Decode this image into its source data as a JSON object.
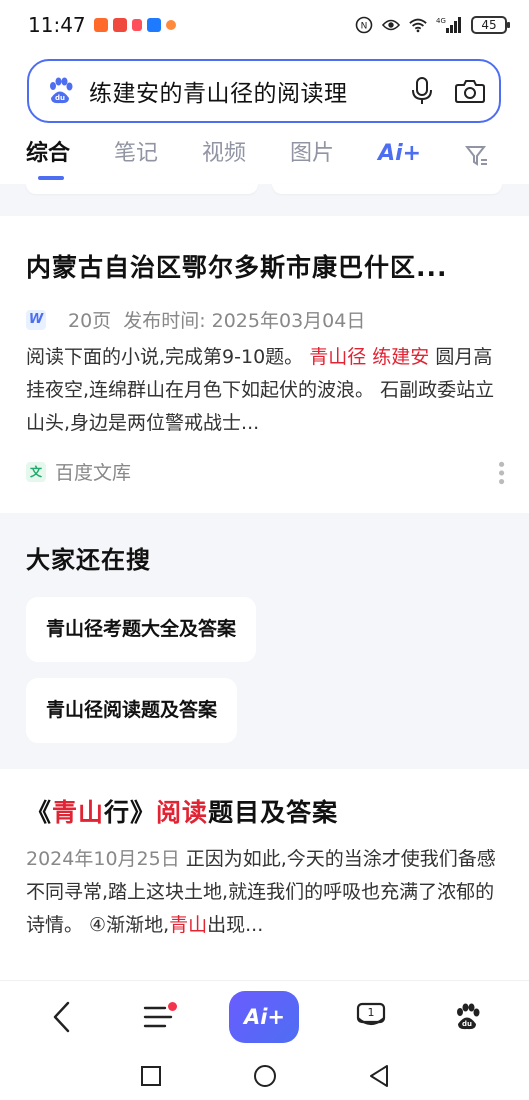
{
  "status_bar": {
    "time": "11:47",
    "network": "4G",
    "battery": "45"
  },
  "search": {
    "query": "练建安的青山径的阅读理"
  },
  "tabs": [
    {
      "label": "综合"
    },
    {
      "label": "笔记"
    },
    {
      "label": "视频"
    },
    {
      "label": "图片"
    },
    {
      "label": "Ai+"
    }
  ],
  "result1": {
    "title": "内蒙古自治区鄂尔多斯市康巴什区...",
    "pages": "20页",
    "publish": "发布时间: 2025年03月04日",
    "snippet_a": "阅读下面的小说,完成第9-10题。",
    "snippet_hl": "青山径 练建安",
    "snippet_b": "圆月高挂夜空,连绵群山在月色下如起伏的波浪。 石副政委站立山头,身边是两位警戒战士...",
    "source": "百度文库",
    "source_icon": "文",
    "type_icon": "W"
  },
  "related": {
    "title": "大家还在搜",
    "items": [
      "青山径考题大全及答案",
      "青山径阅读题及答案"
    ]
  },
  "result2": {
    "title_a": "《",
    "title_b": "青山",
    "title_c": "行》",
    "title_d": "阅读",
    "title_e": "题目及答案",
    "date": "2024年10月25日",
    "snippet_a": "正因为如此,今天的当涂才使我们备感不同寻常,踏上这块土地,就连我们的呼吸也充满了浓郁的诗情。 ④渐渐地,",
    "snippet_hl": "青山",
    "snippet_b": "出现..."
  },
  "bottom_nav": {
    "ai_label": "Ai+",
    "tab_count": "1"
  },
  "colors": {
    "accent": "#4e6ef2",
    "highlight": "#e02433"
  }
}
